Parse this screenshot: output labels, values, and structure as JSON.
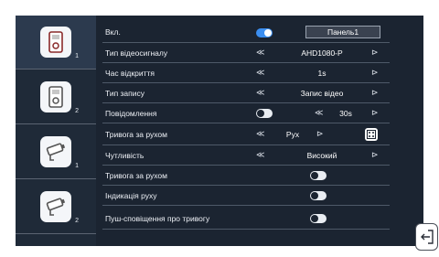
{
  "sidebar": {
    "items": [
      {
        "icon": "doorbell-panel-icon",
        "number": "1",
        "active": true
      },
      {
        "icon": "doorbell-panel-icon",
        "number": "2",
        "active": false
      },
      {
        "icon": "cctv-camera-icon",
        "number": "1",
        "active": false
      },
      {
        "icon": "cctv-camera-icon",
        "number": "2",
        "active": false
      }
    ]
  },
  "settings": {
    "enabled": {
      "label": "Вкл.",
      "toggle": "on",
      "panel_button": "Панель1"
    },
    "video_signal": {
      "label": "Тип відеосигналу",
      "left_arrow": "≪",
      "value": "AHD1080-P",
      "right_arrow": "⊳"
    },
    "open_time": {
      "label": "Час відкриття",
      "left_arrow": "≪",
      "value": "1s",
      "right_arrow": "⊳"
    },
    "record_type": {
      "label": "Тип запису",
      "left_arrow": "≪",
      "value": "Запис відео",
      "right_arrow": "⊳"
    },
    "message": {
      "label": "Повідомлення",
      "toggle": "off",
      "left_arrow": "≪",
      "value": "30s",
      "right_arrow": "⊳"
    },
    "motion_alarm": {
      "label": "Тривога за рухом",
      "left_arrow": "≪",
      "value": "Рух",
      "right_arrow": "⊳"
    },
    "sensitivity": {
      "label": "Чутливість",
      "left_arrow": "≪",
      "value": "Високий",
      "right_arrow": "⊳"
    },
    "motion_alarm_toggle": {
      "label": "Тривога за рухом",
      "toggle": "off"
    },
    "motion_indication": {
      "label": "Індикація руху",
      "toggle": "off"
    },
    "push_alarm": {
      "label": "Пуш-сповіщення про тривогу",
      "toggle": "off"
    }
  },
  "colors": {
    "background": "#1b2431",
    "sidebar": "#1f2a38",
    "toggle_on": "#3b8ef0",
    "toggle_off": "#e9edf2"
  },
  "exit_button": {
    "icon": "exit-icon"
  }
}
